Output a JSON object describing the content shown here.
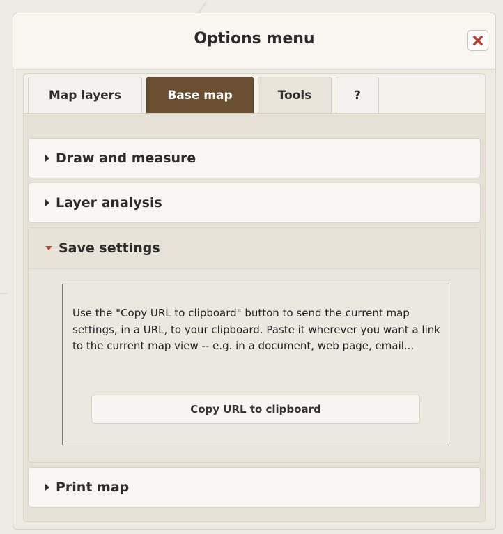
{
  "dialog": {
    "title": "Options menu",
    "close_icon": "close-x-icon",
    "accent_close": "#c0392b"
  },
  "tabs": [
    {
      "label": "Map layers"
    },
    {
      "label": "Base map"
    },
    {
      "label": "Tools"
    },
    {
      "label": "?"
    }
  ],
  "accordion": {
    "items": [
      {
        "label": "Draw and measure",
        "expanded": false
      },
      {
        "label": "Layer analysis",
        "expanded": false
      },
      {
        "label": "Save settings",
        "expanded": true
      },
      {
        "label": "Print map",
        "expanded": false
      }
    ],
    "save_settings": {
      "description": "Use the \"Copy URL to clipboard\" button to send the current map settings, in a URL, to your clipboard. Paste it wherever you want a link to the current map view -- e.g. in a document, web page, email...",
      "button_label": "Copy URL to clipboard"
    }
  },
  "colors": {
    "active_tab": "#6b4f31",
    "expanded_caret": "#b04a2a"
  }
}
